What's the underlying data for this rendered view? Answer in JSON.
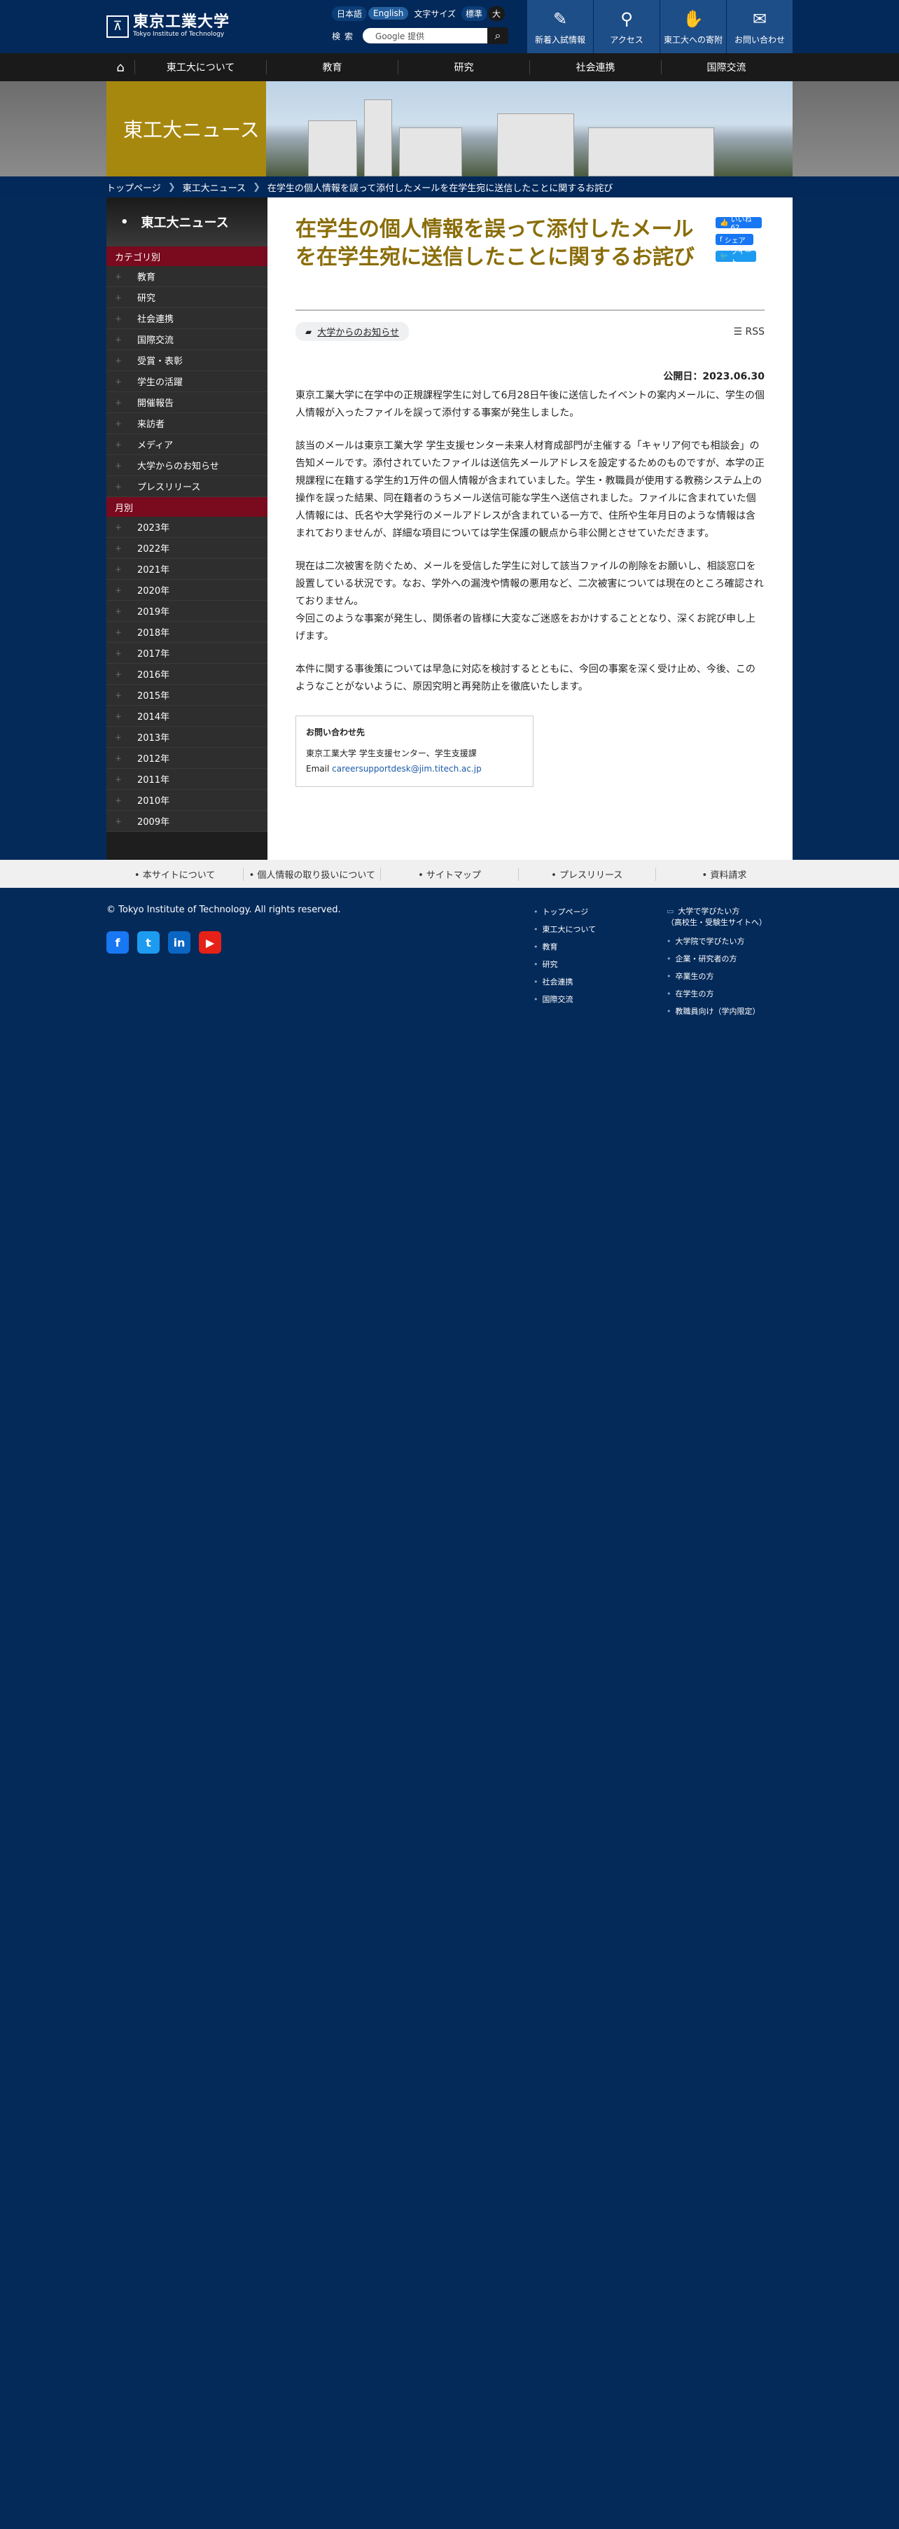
{
  "header": {
    "logo_ja": "東京工業大学",
    "logo_en": "Tokyo Institute of Technology",
    "lang": [
      "日本語",
      "English"
    ],
    "fontsize_label": "文字サイズ",
    "fontsize": [
      "標準",
      "大"
    ],
    "search_label": "検索",
    "search_placeholder": "Google 提供",
    "nav": [
      "新着入試情報",
      "アクセス",
      "東工大への寄附",
      "お問い合わせ"
    ]
  },
  "gnav": [
    "東工大について",
    "教育",
    "研究",
    "社会連携",
    "国際交流"
  ],
  "hero": {
    "title": "東工大ニュース"
  },
  "breadcrumb": [
    "トップページ",
    "東工大ニュース",
    "在学生の個人情報を誤って添付したメールを在学生宛に送信したことに関するお詫び"
  ],
  "sidebar": {
    "title": "東工大ニュース",
    "cat_label": "カテゴリ別",
    "categories": [
      "教育",
      "研究",
      "社会連携",
      "国際交流",
      "受賞・表彰",
      "学生の活躍",
      "開催報告",
      "来訪者",
      "メディア",
      "大学からのお知らせ",
      "プレスリリース"
    ],
    "month_label": "月別",
    "years": [
      "2023年",
      "2022年",
      "2021年",
      "2020年",
      "2019年",
      "2018年",
      "2017年",
      "2016年",
      "2015年",
      "2014年",
      "2013年",
      "2012年",
      "2011年",
      "2010年",
      "2009年"
    ]
  },
  "article": {
    "title": "在学生の個人情報を誤って添付したメールを在学生宛に送信したことに関するお詫び",
    "social": {
      "fb_like": "いいね 62",
      "fb_share": "シェア",
      "tweet": "ツイート"
    },
    "tag": "大学からのお知らせ",
    "rss": "RSS",
    "date": "公開日：2023.06.30",
    "paras": [
      "東京工業大学に在学中の正規課程学生に対して6月28日午後に送信したイベントの案内メールに、学生の個人情報が入ったファイルを誤って添付する事案が発生しました。",
      "該当のメールは東京工業大学 学生支援センター未来人材育成部門が主催する「キャリア何でも相談会」の告知メールです。添付されていたファイルは送信先メールアドレスを設定するためのものですが、本学の正規課程に在籍する学生約1万件の個人情報が含まれていました。学生・教職員が使用する教務システム上の操作を誤った結果、同在籍者のうちメール送信可能な学生へ送信されました。ファイルに含まれていた個人情報には、氏名や大学発行のメールアドレスが含まれている一方で、住所や生年月日のような情報は含まれておりませんが、詳細な項目については学生保護の観点から非公開とさせていただきます。",
      "現在は二次被害を防ぐため、メールを受信した学生に対して該当ファイルの削除をお願いし、相談窓口を設置している状況です。なお、学外への漏洩や情報の悪用など、二次被害については現在のところ確認されておりません。\n今回このような事案が発生し、関係者の皆様に大変なご迷惑をおかけすることとなり、深くお詫び申し上げます。",
      "本件に関する事後策については早急に対応を検討するとともに、今回の事案を深く受け止め、今後、このようなことがないように、原因究明と再発防止を徹底いたします。"
    ],
    "contact": {
      "title": "お問い合わせ先",
      "org": "東京工業大学 学生支援センター、学生支援課",
      "email_label": "Email",
      "email": "careersupportdesk@jim.titech.ac.jp"
    }
  },
  "footer_links": [
    "本サイトについて",
    "個人情報の取り扱いについて",
    "サイトマップ",
    "プレスリリース",
    "資料請求"
  ],
  "footer": {
    "copyright": "© Tokyo Institute of Technology. All rights reserved.",
    "sns": [
      "facebook-icon",
      "twitter-icon",
      "linkedin-icon",
      "youtube-icon"
    ],
    "col1": [
      "トップページ",
      "東工大について",
      "教育",
      "研究",
      "社会連携",
      "国際交流"
    ],
    "col2_title": "大学で学びたい方\n（高校生・受験生サイトへ）",
    "col2": [
      "大学院で学びたい方",
      "企業・研究者の方",
      "卒業生の方",
      "在学生の方",
      "教職員向け（学内限定）"
    ]
  }
}
